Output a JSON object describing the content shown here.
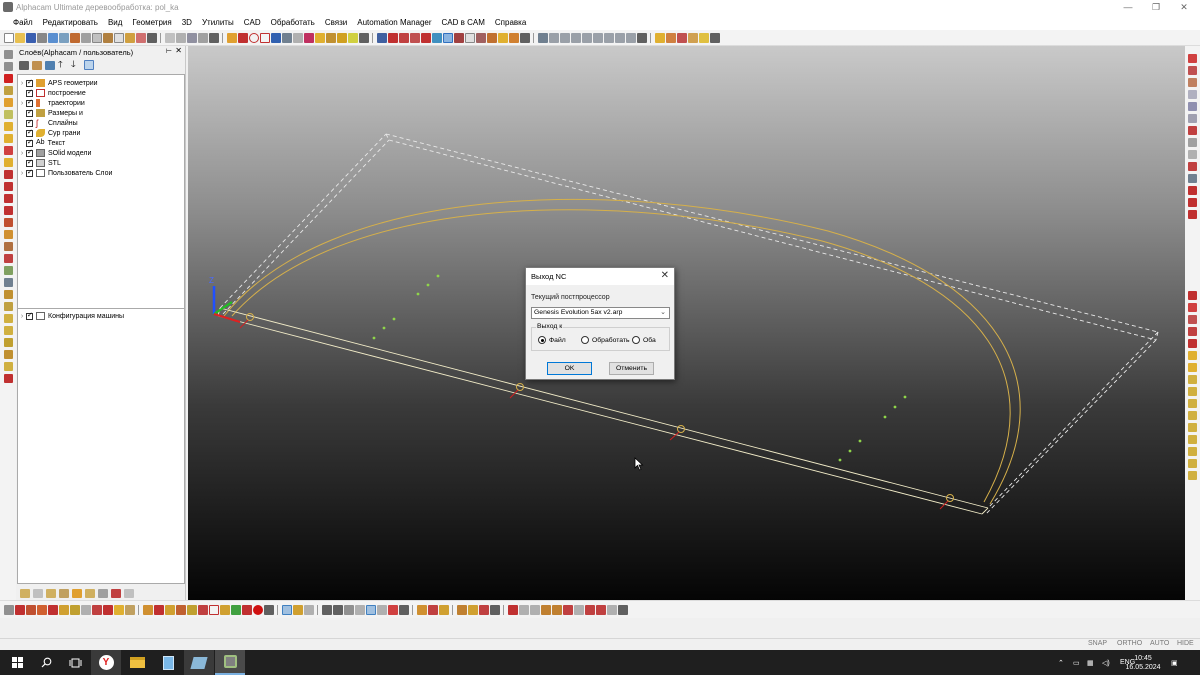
{
  "window": {
    "title": "Alphacam Ultimate деревообработка: pol_ka",
    "controls": [
      "minimize-icon",
      "restore-icon",
      "close-icon"
    ]
  },
  "menu": [
    "Файл",
    "Редактировать",
    "Вид",
    "Геометрия",
    "3D",
    "Утилиты",
    "CAD",
    "Обработать",
    "Связи",
    "Automation Manager",
    "CAD в CAM",
    "Справка"
  ],
  "layers_panel": {
    "title": "Слоёв(Alphacam / пользователь)",
    "items": [
      {
        "label": "APS геометрии",
        "checked": true,
        "expandable": true
      },
      {
        "label": "построение",
        "checked": true,
        "expandable": false
      },
      {
        "label": "траектории",
        "checked": true,
        "expandable": true
      },
      {
        "label": "Размеры и",
        "checked": true,
        "expandable": false
      },
      {
        "label": "Сплайны",
        "checked": true,
        "expandable": false
      },
      {
        "label": "Сур грани",
        "checked": true,
        "expandable": false
      },
      {
        "label": "Текст",
        "checked": true,
        "expandable": false
      },
      {
        "label": "SOlid модели",
        "checked": true,
        "expandable": true
      },
      {
        "label": "STL",
        "checked": true,
        "expandable": false
      },
      {
        "label": "Пользователь Слои",
        "checked": true,
        "expandable": true
      }
    ],
    "text_icon_glyph": "Ab",
    "machine_items": [
      {
        "label": "Конфигурация машины",
        "checked": true,
        "expandable": true
      }
    ]
  },
  "dialog": {
    "title": "Выход NC",
    "postprocessor_label": "Текущий постпроцессор",
    "postprocessor_value": "Genesis Evolution 5ax v2.arp",
    "output_group_label": "Выход к",
    "options": [
      {
        "label": "Файл",
        "selected": true
      },
      {
        "label": "Обработать",
        "selected": false
      },
      {
        "label": "Оба",
        "selected": false
      }
    ],
    "ok_label": "OK",
    "cancel_label": "Отменить"
  },
  "viewport": {
    "axis_label": "Z"
  },
  "statusbar": {
    "flags": [
      "SNAP",
      "ORTHO",
      "AUTO",
      "HIDE"
    ]
  },
  "taskbar": {
    "language": "ENG",
    "time": "10:45",
    "date": "16.05.2024"
  },
  "colors": {
    "path_yellow": "#d6b04a",
    "toolpath_line": "#f2ecc8",
    "tool_cyan": "#35d4d4",
    "tool_green": "#8fd54a",
    "axis_x": "#e02020",
    "axis_y": "#20c020",
    "axis_z": "#2050ff"
  }
}
